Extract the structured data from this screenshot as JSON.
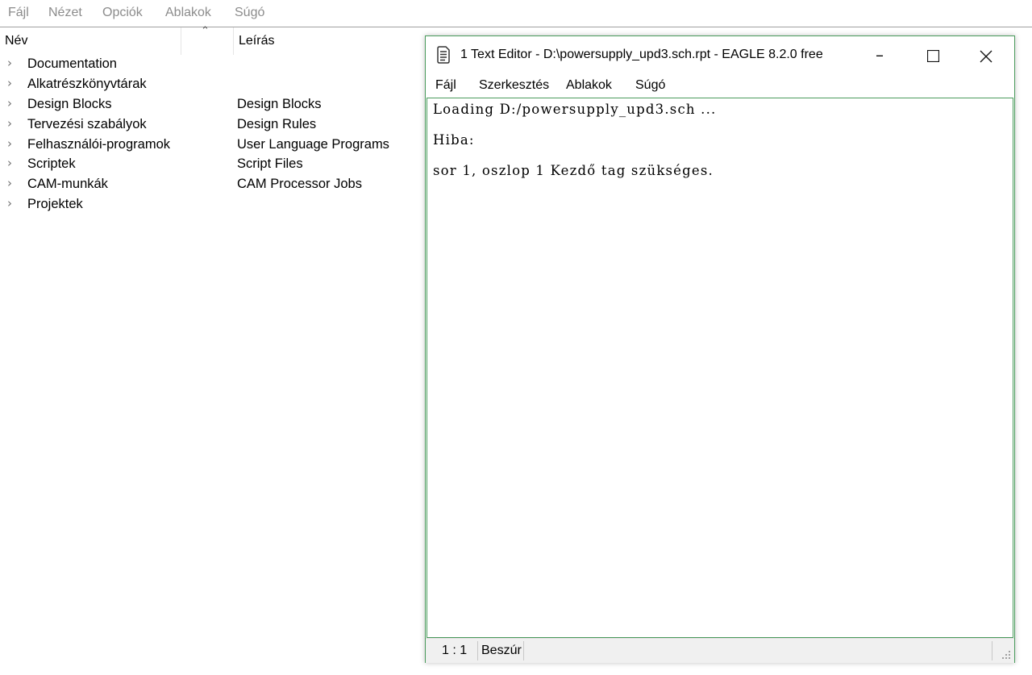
{
  "main_menu": {
    "items": [
      {
        "label": "Fájl"
      },
      {
        "label": "Nézet"
      },
      {
        "label": "Opciók"
      },
      {
        "label": "Ablakok"
      },
      {
        "label": "Súgó"
      }
    ]
  },
  "tree": {
    "columns": {
      "name": "Név",
      "description": "Leírás"
    },
    "rows": [
      {
        "name": "Documentation",
        "desc": ""
      },
      {
        "name": "Alkatrészkönyvtárak",
        "desc": ""
      },
      {
        "name": "Design Blocks",
        "desc": "Design Blocks"
      },
      {
        "name": "Tervezési szabályok",
        "desc": "Design Rules"
      },
      {
        "name": "Felhasználói-programok",
        "desc": "User Language Programs"
      },
      {
        "name": "Scriptek",
        "desc": "Script Files"
      },
      {
        "name": "CAM-munkák",
        "desc": "CAM Processor Jobs"
      },
      {
        "name": "Projektek",
        "desc": ""
      }
    ]
  },
  "editor": {
    "title": "1 Text Editor - D:\\powersupply_upd3.sch.rpt - EAGLE 8.2.0 free",
    "menu": [
      {
        "label": "Fájl"
      },
      {
        "label": "Szerkesztés"
      },
      {
        "label": "Ablakok"
      },
      {
        "label": "Súgó"
      }
    ],
    "content": [
      "Loading D:/powersupply_upd3.sch ...",
      "Hiba:",
      "sor 1, oszlop 1 Kezdő tag szükséges."
    ],
    "status": {
      "position": "1 : 1",
      "mode": "Beszúr"
    }
  },
  "colors": {
    "editor_border": "#4a9b5c",
    "disabled_menu": "#8c8c8c"
  }
}
